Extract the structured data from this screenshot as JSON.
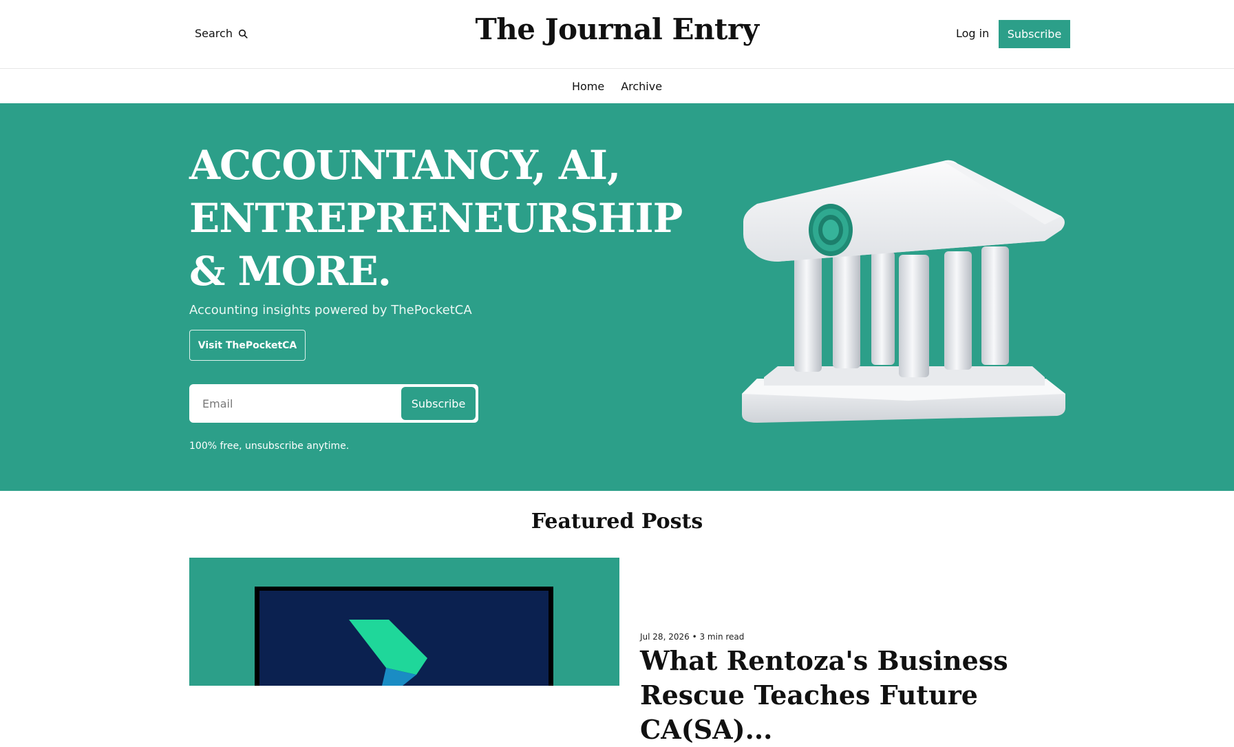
{
  "header": {
    "search_label": "Search",
    "brand": "The Journal Entry",
    "login_label": "Log in",
    "subscribe_label": "Subscribe"
  },
  "nav": {
    "items": [
      {
        "label": "Home"
      },
      {
        "label": "Archive"
      }
    ]
  },
  "hero": {
    "title": "ACCOUNTANCY, AI, ENTREPRENEURSHIP & MORE.",
    "subtitle": "Accounting insights powered by ThePocketCA",
    "visit_label": "Visit ThePocketCA",
    "email_placeholder": "Email",
    "submit_label": "Subscribe",
    "fine_print": "100% free, unsubscribe anytime.",
    "art_icon": "bank-building-icon"
  },
  "featured": {
    "heading": "Featured Posts",
    "posts": [
      {
        "date": "Jul 28, 2026",
        "read_time": "3 min read",
        "title": "What Rentoza's Business Rescue Teaches Future CA(SA)..."
      }
    ]
  },
  "colors": {
    "accent": "#2c9f89",
    "text": "#111111",
    "background": "#ffffff"
  }
}
